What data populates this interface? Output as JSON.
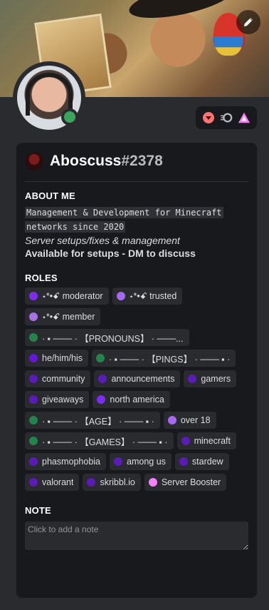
{
  "profile": {
    "username": "Aboscuss",
    "discriminator": "#2378",
    "status_color": "#3ba55d",
    "badges": [
      {
        "icon": "nitro-booster-badge",
        "color": "#ff7373"
      },
      {
        "icon": "nitro-badge",
        "color": "#b9bbbe"
      },
      {
        "icon": "hypesquad-badge",
        "color": "#ff73fa"
      }
    ]
  },
  "about": {
    "title": "ABOUT ME",
    "code_line1": "Management & Development for Minecraft",
    "code_line2": "networks since 2020",
    "italic_line": "Server setups/fixes & management",
    "bold_line": "Available for setups - DM to discuss"
  },
  "roles": {
    "title": "ROLES",
    "items": [
      {
        "label": "⋆*•ꗃ moderator",
        "color": "#7d2cf5"
      },
      {
        "label": "⋆*•ꗃ trusted",
        "color": "#a668f2"
      },
      {
        "label": "⋆*•ꗃ member",
        "color": "#a970e8"
      },
      {
        "label": "· ▪ ─── · 【PRONOUNS】 · ───...",
        "color": "#23834c"
      },
      {
        "label": "he/him/his",
        "color": "#6616d6"
      },
      {
        "label": "· ▪ ─── · 【PINGS】 · ─── ▪ ·",
        "color": "#23834c"
      },
      {
        "label": "community",
        "color": "#5b1bb8"
      },
      {
        "label": "announcements",
        "color": "#5b1bb8"
      },
      {
        "label": "gamers",
        "color": "#5b1bb8"
      },
      {
        "label": "giveaways",
        "color": "#5b1bb8"
      },
      {
        "label": "north america",
        "color": "#7d2cf5"
      },
      {
        "label": "· ▪ ─── · 【AGE】 · ─── ▪ ·",
        "color": "#23834c"
      },
      {
        "label": "over 18",
        "color": "#a668f2"
      },
      {
        "label": "· ▪ ─── · 【GAMES】 · ─── ▪ ·",
        "color": "#23834c"
      },
      {
        "label": "minecraft",
        "color": "#5b1bb8"
      },
      {
        "label": "phasmophobia",
        "color": "#5b1bb8"
      },
      {
        "label": "among us",
        "color": "#5b1bb8"
      },
      {
        "label": "stardew",
        "color": "#5b1bb8"
      },
      {
        "label": "valorant",
        "color": "#5b1bb8"
      },
      {
        "label": "skribbl.io",
        "color": "#5b1bb8"
      },
      {
        "label": "Server Booster",
        "color": "#f47fff"
      }
    ]
  },
  "note": {
    "title": "NOTE",
    "placeholder": "Click to add a note"
  }
}
